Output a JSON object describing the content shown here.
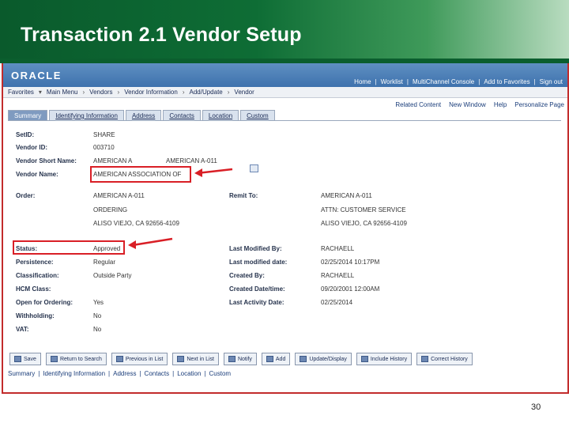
{
  "slide": {
    "title": "Transaction 2.1 Vendor  Setup",
    "page_number": "30"
  },
  "app": {
    "logo": "ORACLE",
    "top_links": [
      "Home",
      "Worklist",
      "MultiChannel Console",
      "Add to Favorites",
      "Sign out"
    ],
    "breadcrumbs": [
      "Favorites",
      "Main Menu",
      "Vendors",
      "Vendor Information",
      "Add/Update",
      "Vendor"
    ],
    "related": [
      "Related Content",
      "New Window",
      "Help",
      "Personalize Page"
    ],
    "tabs": [
      "Summary",
      "Identifying Information",
      "Address",
      "Contacts",
      "Location",
      "Custom"
    ],
    "active_tab": "Summary"
  },
  "fields": {
    "setid_label": "SetID:",
    "setid": "SHARE",
    "vendor_id_label": "Vendor ID:",
    "vendor_id": "003710",
    "short_name_label": "Vendor Short Name:",
    "short_name": "AMERICAN A",
    "short_name_2": "AMERICAN A-011",
    "vendor_name_label": "Vendor Name:",
    "vendor_name": "AMERICAN ASSOCIATION OF",
    "order_label": "Order:",
    "order_1": "AMERICAN A-011",
    "order_2": "ORDERING",
    "order_3": "ALISO VIEJO, CA  92656-4109",
    "remit_label": "Remit To:",
    "remit_1": "AMERICAN A-011",
    "remit_2": "ATTN: CUSTOMER SERVICE",
    "remit_3": "ALISO VIEJO, CA  92656-4109",
    "status_label": "Status:",
    "status": "Approved",
    "persistence_label": "Persistence:",
    "persistence": "Regular",
    "classification_label": "Classification:",
    "classification": "Outside Party",
    "hcm_label": "HCM Class:",
    "hcm": "",
    "open_label": "Open for Ordering:",
    "open": "Yes",
    "withholding_label": "Withholding:",
    "withholding": "No",
    "vat_label": "VAT:",
    "vat": "No",
    "last_mod_by_label": "Last Modified By:",
    "last_mod_by": "RACHAELL",
    "last_mod_date_label": "Last modified date:",
    "last_mod_date": "02/25/2014 10:17PM",
    "created_by_label": "Created By:",
    "created_by": "RACHAELL",
    "created_dt_label": "Created Date/time:",
    "created_dt": "09/20/2001 12:00AM",
    "last_activity_label": "Last Activity Date:",
    "last_activity": "02/25/2014"
  },
  "buttons": [
    "Save",
    "Return to Search",
    "Previous in List",
    "Next in List",
    "Notify",
    "Add",
    "Update/Display",
    "Include History",
    "Correct History"
  ],
  "footer_links": [
    "Summary",
    "Identifying Information",
    "Address",
    "Contacts",
    "Location",
    "Custom"
  ]
}
